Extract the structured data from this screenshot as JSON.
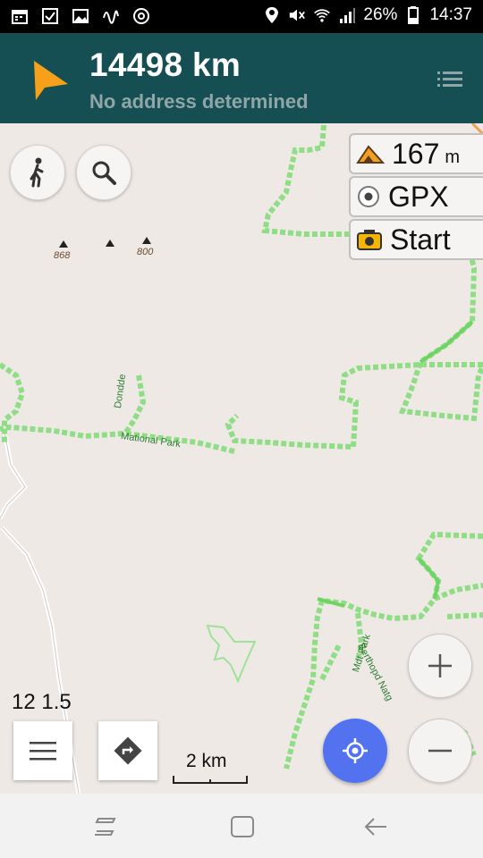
{
  "status_bar": {
    "left_icons": [
      "calendar-icon",
      "checkbox-icon",
      "image-icon",
      "activity-icon",
      "sync-icon"
    ],
    "right_icons": [
      "location-pin-icon",
      "mute-icon",
      "wifi-icon",
      "signal-icon"
    ],
    "battery": "26%",
    "time": "14:37"
  },
  "header": {
    "distance": "14498 km",
    "address": "No address determined",
    "accent_color": "#f7a11a",
    "bg_color": "#164f53"
  },
  "map": {
    "peaks": [
      {
        "label": "868"
      },
      {
        "label": ""
      },
      {
        "label": "800"
      }
    ],
    "park_labels": [
      "Dondde",
      "Mational Park",
      "Berthopd Natg",
      "Mdt Park"
    ],
    "trail_color": "#8fdd85"
  },
  "info_panel": {
    "altitude_value": "167",
    "altitude_unit": "m",
    "gpx_label": "GPX",
    "start_label": "Start"
  },
  "controls": {
    "zoom_text": "12 1.5",
    "scale_label": "2 km",
    "locate_color": "#5372f0"
  }
}
